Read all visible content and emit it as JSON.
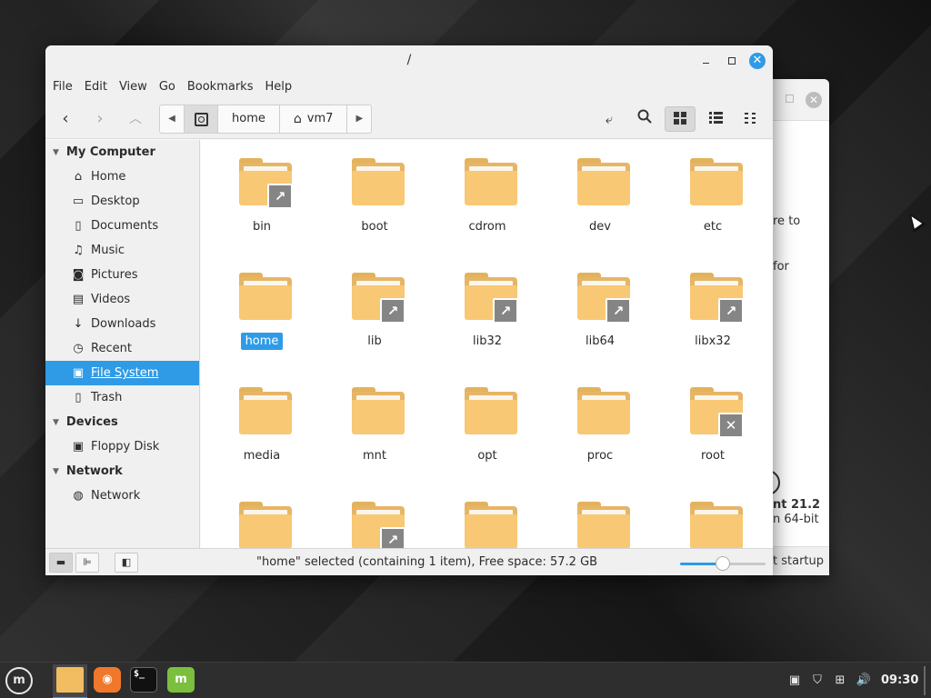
{
  "background_window": {
    "text_lines": [
      "re to",
      "for"
    ],
    "bold_text": "nt 21.2",
    "sub_text": "n 64-bit",
    "footer_text": "t startup"
  },
  "window": {
    "title": "/"
  },
  "menubar": {
    "items": [
      "File",
      "Edit",
      "View",
      "Go",
      "Bookmarks",
      "Help"
    ]
  },
  "toolbar": {
    "back_icon": "back-arrow-icon",
    "forward_icon": "forward-arrow-icon",
    "up_icon": "up-arrow-icon",
    "path": {
      "filesystem_icon": "filesystem-icon",
      "segments": [
        "home",
        "vm7"
      ]
    },
    "toggle_location_icon": "location-entry-icon",
    "search_icon": "search-icon",
    "views": {
      "icon_view": "grid-view-icon",
      "list_view": "list-view-icon",
      "compact_view": "compact-view-icon",
      "active": "icon_view"
    }
  },
  "sidebar": {
    "sections": [
      {
        "title": "My Computer",
        "items": [
          {
            "label": "Home",
            "icon": "home-icon"
          },
          {
            "label": "Desktop",
            "icon": "desktop-icon"
          },
          {
            "label": "Documents",
            "icon": "documents-icon"
          },
          {
            "label": "Music",
            "icon": "music-icon"
          },
          {
            "label": "Pictures",
            "icon": "pictures-icon"
          },
          {
            "label": "Videos",
            "icon": "videos-icon"
          },
          {
            "label": "Downloads",
            "icon": "downloads-icon"
          },
          {
            "label": "Recent",
            "icon": "recent-icon"
          },
          {
            "label": "File System",
            "icon": "filesystem-icon",
            "selected": true
          },
          {
            "label": "Trash",
            "icon": "trash-icon"
          }
        ]
      },
      {
        "title": "Devices",
        "items": [
          {
            "label": "Floppy Disk",
            "icon": "floppy-disk-icon"
          }
        ]
      },
      {
        "title": "Network",
        "items": [
          {
            "label": "Network",
            "icon": "network-icon"
          }
        ]
      }
    ]
  },
  "folders": [
    {
      "name": "bin",
      "emblem": "symlink"
    },
    {
      "name": "boot",
      "emblem": ""
    },
    {
      "name": "cdrom",
      "emblem": ""
    },
    {
      "name": "dev",
      "emblem": ""
    },
    {
      "name": "etc",
      "emblem": ""
    },
    {
      "name": "home",
      "emblem": "",
      "selected": true
    },
    {
      "name": "lib",
      "emblem": "symlink"
    },
    {
      "name": "lib32",
      "emblem": "symlink"
    },
    {
      "name": "lib64",
      "emblem": "symlink"
    },
    {
      "name": "libx32",
      "emblem": "symlink"
    },
    {
      "name": "media",
      "emblem": ""
    },
    {
      "name": "mnt",
      "emblem": ""
    },
    {
      "name": "opt",
      "emblem": ""
    },
    {
      "name": "proc",
      "emblem": ""
    },
    {
      "name": "root",
      "emblem": "unreadable"
    },
    {
      "name": "",
      "emblem": ""
    },
    {
      "name": "",
      "emblem": "symlink"
    },
    {
      "name": "",
      "emblem": ""
    },
    {
      "name": "",
      "emblem": ""
    },
    {
      "name": "",
      "emblem": ""
    }
  ],
  "statusbar": {
    "text": "\"home\" selected (containing 1 item), Free space: 57.2 GB",
    "zoom_level": 0.5
  },
  "taskbar": {
    "menu_icon": "mint-menu-icon",
    "apps": [
      {
        "name": "files",
        "icon": "folder-icon",
        "active": true
      },
      {
        "name": "firefox",
        "icon": "firefox-icon",
        "active": false
      },
      {
        "name": "terminal",
        "icon": "terminal-icon",
        "active": false
      },
      {
        "name": "software-manager",
        "icon": "mintinstall-icon",
        "active": false
      }
    ],
    "tray_icons": [
      "update-manager-icon",
      "shield-icon",
      "network-icon",
      "volume-icon"
    ],
    "clock": "09:30"
  }
}
